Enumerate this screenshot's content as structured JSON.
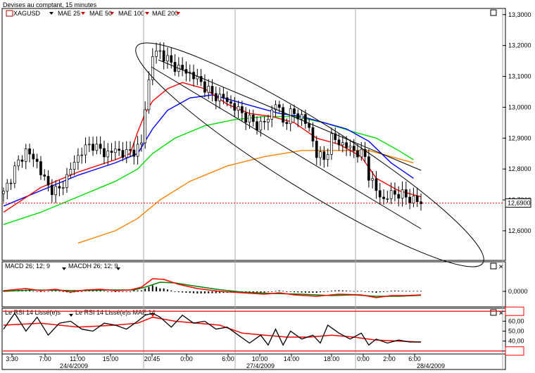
{
  "window": {
    "title": "Devises au comptant, 15 minutes"
  },
  "colors": {
    "ma25": "#ff0000",
    "ma50": "#0000ff",
    "ma100": "#00dd00",
    "ma200": "#ff8000",
    "price_line": "#ff0000",
    "macd": "#ff0000",
    "macdh_signal": "#008000",
    "rsi": "#000000",
    "rsi_ma": "#ff0000",
    "rsi_bounds": "#ff0000"
  },
  "chart_data": [
    {
      "type": "candlestick",
      "symbol": "XAGUSD",
      "legend": [
        "XAGUSD",
        "MAE 25",
        "MAE 50",
        "MAE 100",
        "MAE 200"
      ],
      "y_ticks": [
        "13,3000",
        "13,2000",
        "13,1000",
        "13,0000",
        "12,9000",
        "12,8000",
        "12,7000",
        "12,6000"
      ],
      "ylim": [
        12.52,
        13.32
      ],
      "current_price_label": "12,6900",
      "current_price": 12.69,
      "x_time_labels": [
        "3:30",
        "7:00",
        "11:00",
        "15:00",
        "20:45",
        "0:00",
        "6:00",
        "10:00",
        "14:00",
        "18:00",
        "0:00",
        "2:00",
        "6:00"
      ],
      "x_date_labels": [
        "24/4/2009",
        "27/4/2009",
        "28/4/2009"
      ],
      "price_path": [
        [
          0,
          12.72
        ],
        [
          3,
          12.8
        ],
        [
          6,
          12.86
        ],
        [
          9,
          12.82
        ],
        [
          12,
          12.74
        ],
        [
          15,
          12.73
        ],
        [
          18,
          12.8
        ],
        [
          21,
          12.86
        ],
        [
          24,
          12.88
        ],
        [
          27,
          12.85
        ],
        [
          30,
          12.86
        ],
        [
          33,
          12.85
        ],
        [
          35,
          12.86
        ],
        [
          37,
          12.88
        ],
        [
          38,
          13.0
        ],
        [
          40,
          13.17
        ],
        [
          42,
          13.18
        ],
        [
          45,
          13.14
        ],
        [
          48,
          13.12
        ],
        [
          50,
          13.11
        ],
        [
          53,
          13.08
        ],
        [
          56,
          13.04
        ],
        [
          59,
          13.03
        ],
        [
          62,
          13.0
        ],
        [
          65,
          12.97
        ],
        [
          68,
          12.94
        ],
        [
          71,
          12.96
        ],
        [
          73,
          13.02
        ],
        [
          75,
          12.95
        ],
        [
          77,
          12.98
        ],
        [
          80,
          12.97
        ],
        [
          82,
          12.93
        ],
        [
          84,
          12.85
        ],
        [
          86,
          12.83
        ],
        [
          88,
          12.9
        ],
        [
          91,
          12.88
        ],
        [
          94,
          12.86
        ],
        [
          97,
          12.84
        ],
        [
          98,
          12.78
        ],
        [
          100,
          12.73
        ],
        [
          102,
          12.7
        ],
        [
          104,
          12.72
        ],
        [
          106,
          12.72
        ],
        [
          108,
          12.71
        ],
        [
          110,
          12.7
        ],
        [
          112,
          12.69
        ]
      ],
      "ma25_path": [
        [
          0,
          12.66
        ],
        [
          10,
          12.74
        ],
        [
          20,
          12.79
        ],
        [
          30,
          12.83
        ],
        [
          34,
          12.85
        ],
        [
          36,
          12.92
        ],
        [
          38,
          12.98
        ],
        [
          40,
          13.02
        ],
        [
          44,
          13.06
        ],
        [
          48,
          13.08
        ],
        [
          54,
          13.06
        ],
        [
          60,
          13.01
        ],
        [
          66,
          12.98
        ],
        [
          72,
          12.97
        ],
        [
          78,
          12.95
        ],
        [
          84,
          12.9
        ],
        [
          90,
          12.88
        ],
        [
          96,
          12.84
        ],
        [
          100,
          12.77
        ],
        [
          106,
          12.73
        ],
        [
          112,
          12.71
        ]
      ],
      "ma50_path": [
        [
          0,
          12.68
        ],
        [
          10,
          12.73
        ],
        [
          20,
          12.78
        ],
        [
          30,
          12.82
        ],
        [
          36,
          12.85
        ],
        [
          40,
          12.93
        ],
        [
          44,
          12.99
        ],
        [
          50,
          13.03
        ],
        [
          56,
          13.04
        ],
        [
          62,
          13.02
        ],
        [
          68,
          13.0
        ],
        [
          74,
          12.98
        ],
        [
          80,
          12.97
        ],
        [
          86,
          12.95
        ],
        [
          92,
          12.93
        ],
        [
          98,
          12.89
        ],
        [
          104,
          12.82
        ],
        [
          110,
          12.77
        ]
      ],
      "ma100_path": [
        [
          0,
          12.62
        ],
        [
          10,
          12.66
        ],
        [
          20,
          12.71
        ],
        [
          30,
          12.76
        ],
        [
          36,
          12.8
        ],
        [
          40,
          12.85
        ],
        [
          46,
          12.9
        ],
        [
          54,
          12.94
        ],
        [
          62,
          12.96
        ],
        [
          70,
          12.97
        ],
        [
          78,
          12.97
        ],
        [
          86,
          12.95
        ],
        [
          94,
          12.92
        ],
        [
          100,
          12.9
        ],
        [
          106,
          12.86
        ],
        [
          110,
          12.83
        ]
      ],
      "ma200_path": [
        [
          20,
          12.56
        ],
        [
          30,
          12.6
        ],
        [
          36,
          12.64
        ],
        [
          42,
          12.7
        ],
        [
          50,
          12.76
        ],
        [
          60,
          12.81
        ],
        [
          70,
          12.84
        ],
        [
          80,
          12.86
        ],
        [
          90,
          12.86
        ],
        [
          98,
          12.86
        ],
        [
          104,
          12.84
        ],
        [
          110,
          12.82
        ]
      ]
    },
    {
      "type": "line",
      "title": "MACD  26; 12; 9",
      "legend": [
        "MACD  26; 12; 9",
        "MACDH 26; 12; 9"
      ],
      "y_ticks": [
        "0,0000"
      ],
      "ylim": [
        -1,
        1
      ],
      "macd_path": [
        [
          0,
          0.05
        ],
        [
          6,
          0.2
        ],
        [
          10,
          0.05
        ],
        [
          14,
          0.15
        ],
        [
          18,
          -0.05
        ],
        [
          22,
          0.1
        ],
        [
          26,
          0.15
        ],
        [
          30,
          0.05
        ],
        [
          34,
          0.1
        ],
        [
          37,
          0.3
        ],
        [
          40,
          0.9
        ],
        [
          43,
          0.85
        ],
        [
          47,
          0.5
        ],
        [
          52,
          0.2
        ],
        [
          58,
          0.0
        ],
        [
          64,
          -0.1
        ],
        [
          70,
          -0.2
        ],
        [
          74,
          -0.1
        ],
        [
          78,
          -0.25
        ],
        [
          84,
          -0.35
        ],
        [
          90,
          -0.2
        ],
        [
          96,
          -0.25
        ],
        [
          100,
          -0.45
        ],
        [
          104,
          -0.3
        ],
        [
          108,
          -0.3
        ],
        [
          112,
          -0.25
        ]
      ],
      "signal_path": [
        [
          0,
          0.0
        ],
        [
          8,
          0.1
        ],
        [
          14,
          0.08
        ],
        [
          20,
          0.05
        ],
        [
          28,
          0.1
        ],
        [
          35,
          0.1
        ],
        [
          38,
          0.3
        ],
        [
          42,
          0.65
        ],
        [
          46,
          0.6
        ],
        [
          52,
          0.35
        ],
        [
          58,
          0.12
        ],
        [
          64,
          -0.05
        ],
        [
          72,
          -0.15
        ],
        [
          80,
          -0.2
        ],
        [
          88,
          -0.3
        ],
        [
          94,
          -0.25
        ],
        [
          100,
          -0.35
        ],
        [
          106,
          -0.35
        ],
        [
          112,
          -0.28
        ]
      ]
    },
    {
      "type": "line",
      "title": "Le RSI 14 Lissé(e)s",
      "legend": [
        "Le RSI 14 Lissé(e)s",
        "Le RSI 14 Lissé(e)s MAE 14"
      ],
      "y_ticks": [
        "70,00",
        "60,00",
        "50,00",
        "40,00",
        "30,00"
      ],
      "ylim": [
        27,
        73
      ],
      "upper_bound": 70,
      "lower_bound": 30,
      "rsi_path": [
        [
          0,
          52
        ],
        [
          3,
          68
        ],
        [
          6,
          50
        ],
        [
          9,
          64
        ],
        [
          12,
          46
        ],
        [
          15,
          58
        ],
        [
          18,
          60
        ],
        [
          21,
          52
        ],
        [
          24,
          50
        ],
        [
          27,
          58
        ],
        [
          30,
          56
        ],
        [
          33,
          52
        ],
        [
          36,
          60
        ],
        [
          38,
          66
        ],
        [
          40,
          68
        ],
        [
          42,
          64
        ],
        [
          45,
          54
        ],
        [
          48,
          66
        ],
        [
          51,
          58
        ],
        [
          54,
          60
        ],
        [
          57,
          52
        ],
        [
          60,
          54
        ],
        [
          63,
          46
        ],
        [
          66,
          38
        ],
        [
          69,
          46
        ],
        [
          71,
          36
        ],
        [
          73,
          52
        ],
        [
          75,
          36
        ],
        [
          77,
          50
        ],
        [
          80,
          42
        ],
        [
          83,
          46
        ],
        [
          85,
          38
        ],
        [
          87,
          56
        ],
        [
          90,
          48
        ],
        [
          93,
          42
        ],
        [
          96,
          48
        ],
        [
          98,
          36
        ],
        [
          100,
          42
        ],
        [
          103,
          38
        ],
        [
          106,
          41
        ],
        [
          109,
          39
        ],
        [
          112,
          39
        ]
      ],
      "rsi_ma_path": [
        [
          0,
          56
        ],
        [
          10,
          58
        ],
        [
          20,
          54
        ],
        [
          30,
          56
        ],
        [
          36,
          58
        ],
        [
          40,
          64
        ],
        [
          46,
          60
        ],
        [
          52,
          58
        ],
        [
          58,
          56
        ],
        [
          64,
          48
        ],
        [
          70,
          46
        ],
        [
          76,
          44
        ],
        [
          82,
          44
        ],
        [
          88,
          46
        ],
        [
          94,
          44
        ],
        [
          100,
          41
        ],
        [
          106,
          40
        ],
        [
          112,
          39
        ]
      ]
    }
  ]
}
